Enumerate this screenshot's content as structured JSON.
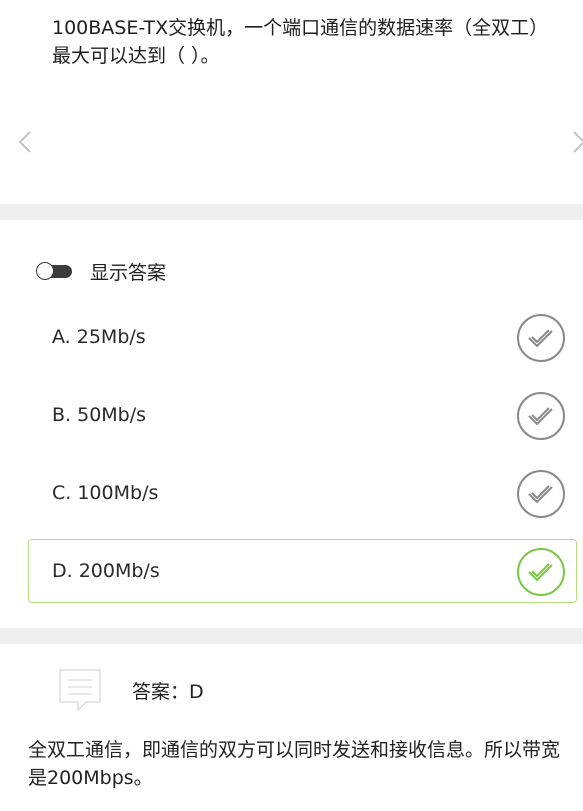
{
  "question": {
    "text": "100BASE-TX交换机，一个端口通信的数据速率（全双工）最大可以达到（ ）。"
  },
  "navigation": {
    "prev_icon": "chevron-left-icon",
    "next_icon": "chevron-right-icon"
  },
  "show_answer": {
    "label": "显示答案",
    "enabled": false
  },
  "options": [
    {
      "label": "A. 25Mb/s",
      "selected": false
    },
    {
      "label": "B. 50Mb/s",
      "selected": false
    },
    {
      "label": "C. 100Mb/s",
      "selected": false
    },
    {
      "label": "D. 200Mb/s",
      "selected": true
    }
  ],
  "answer": {
    "text": "答案：D",
    "icon": "comment-icon"
  },
  "explanation": {
    "text": "全双工通信，即通信的双方可以同时发送和接收信息。所以带宽是200Mbps。"
  },
  "colors": {
    "selected_accent": "#7ac943",
    "unselected_icon": "#8a8a8a",
    "divider": "#efefef"
  }
}
